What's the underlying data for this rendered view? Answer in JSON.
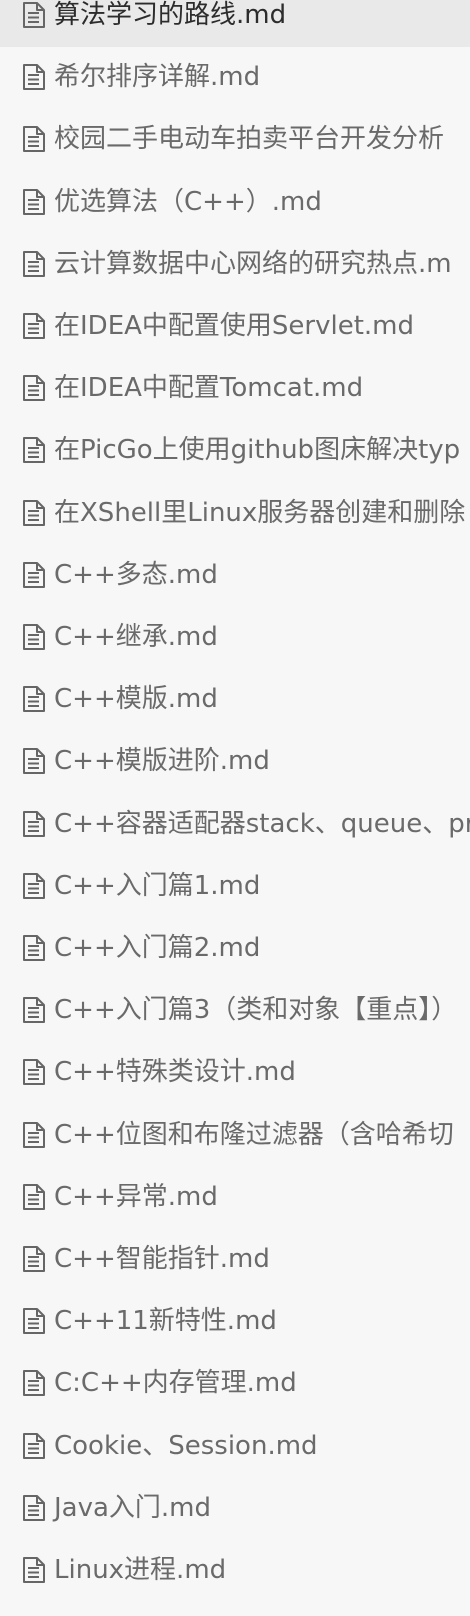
{
  "sidebar": {
    "active_index": 0,
    "icon": "document-icon",
    "colors": {
      "background": "#f7f7f7",
      "active_background": "#e9e9e9",
      "text": "#6a6a6a",
      "active_text": "#2c2c2c",
      "icon": "#666666"
    },
    "files": [
      {
        "label": "算法学习的路线.md"
      },
      {
        "label": "希尔排序详解.md"
      },
      {
        "label": "校园二手电动车拍卖平台开发分析"
      },
      {
        "label": "优选算法（C++）.md"
      },
      {
        "label": "云计算数据中心网络的研究热点.m"
      },
      {
        "label": "在IDEA中配置使用Servlet.md"
      },
      {
        "label": "在IDEA中配置Tomcat.md"
      },
      {
        "label": "在PicGo上使用github图床解决typ"
      },
      {
        "label": "在XShell里Linux服务器创建和删除"
      },
      {
        "label": "C++多态.md"
      },
      {
        "label": "C++继承.md"
      },
      {
        "label": "C++模版.md"
      },
      {
        "label": "C++模版进阶.md"
      },
      {
        "label": "C++容器适配器stack、queue、pr"
      },
      {
        "label": "C++入门篇1.md"
      },
      {
        "label": "C++入门篇2.md"
      },
      {
        "label": "C++入门篇3（类和对象【重点】）"
      },
      {
        "label": "C++特殊类设计.md"
      },
      {
        "label": "C++位图和布隆过滤器（含哈希切"
      },
      {
        "label": "C++异常.md"
      },
      {
        "label": "C++智能指针.md"
      },
      {
        "label": "C++11新特性.md"
      },
      {
        "label": "C:C++内存管理.md"
      },
      {
        "label": "Cookie、Session.md"
      },
      {
        "label": "Java入门.md"
      },
      {
        "label": "Linux进程.md"
      }
    ]
  }
}
